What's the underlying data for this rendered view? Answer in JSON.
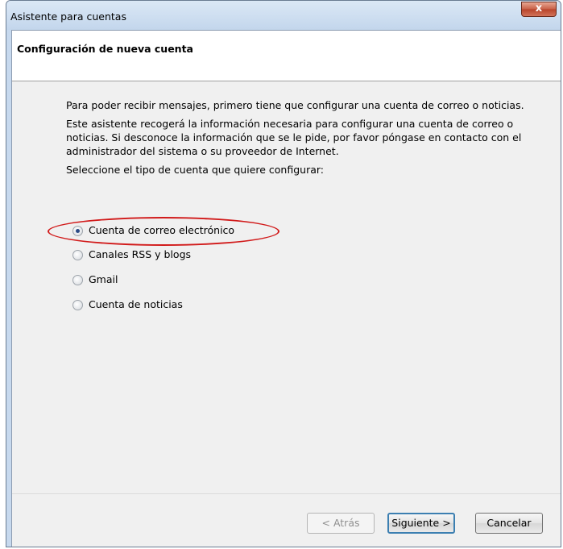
{
  "window": {
    "title": "Asistente para cuentas",
    "close_label": "x"
  },
  "header": {
    "title": "Configuración de nueva cuenta"
  },
  "content": {
    "para1": "Para poder recibir mensajes, primero tiene que configurar una cuenta de correo o noticias.",
    "para2": "Este asistente recogerá la información necesaria para configurar una cuenta de correo o noticias. Si desconoce la información que se le pide, por favor póngase en contacto con el administrador del sistema o su proveedor de Internet.",
    "para3": "Seleccione el tipo de cuenta que quiere configurar:"
  },
  "options": [
    {
      "label": "Cuenta de correo electrónico",
      "selected": true
    },
    {
      "label": "Canales RSS y blogs",
      "selected": false
    },
    {
      "label": "Gmail",
      "selected": false
    },
    {
      "label": "Cuenta de noticias",
      "selected": false
    }
  ],
  "buttons": {
    "back": "< Atrás",
    "next": "Siguiente >",
    "cancel": "Cancelar"
  },
  "colors": {
    "highlight": "#d11a1a",
    "title_bar": "#c7d9ee",
    "close_button": "#c75f46"
  }
}
